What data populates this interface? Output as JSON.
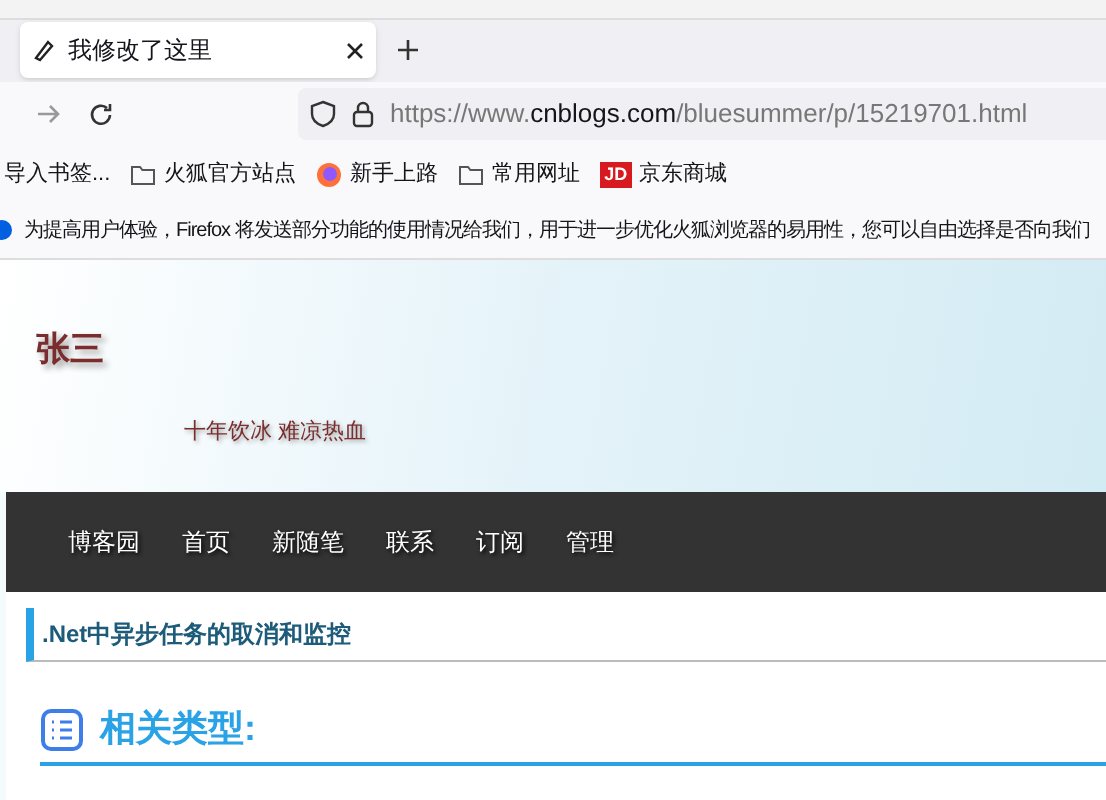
{
  "tabs": [
    {
      "title": "我修改了这里",
      "selected": true
    }
  ],
  "url": {
    "prefix": "https://www.",
    "domain": "cnblogs.com",
    "path": "/bluesummer/p/15219701.html"
  },
  "bookmarks": [
    {
      "kind": "plain",
      "label": "导入书签..."
    },
    {
      "kind": "folder",
      "label": "火狐官方站点"
    },
    {
      "kind": "firefox",
      "label": "新手上路"
    },
    {
      "kind": "folder",
      "label": "常用网址"
    },
    {
      "kind": "jd",
      "label": "京东商城",
      "badge": "JD"
    }
  ],
  "notification": "为提高用户体验，Firefox 将发送部分功能的使用情况给我们，用于进一步优化火狐浏览器的易用性，您可以自由选择是否向我们",
  "blog": {
    "title": "张三",
    "subtitle": "十年饮冰 难凉热血",
    "nav": [
      "博客园",
      "首页",
      "新随笔",
      "联系",
      "订阅",
      "管理"
    ],
    "post_title": ".Net中异步任务的取消和监控",
    "section_heading": "相关类型:"
  }
}
